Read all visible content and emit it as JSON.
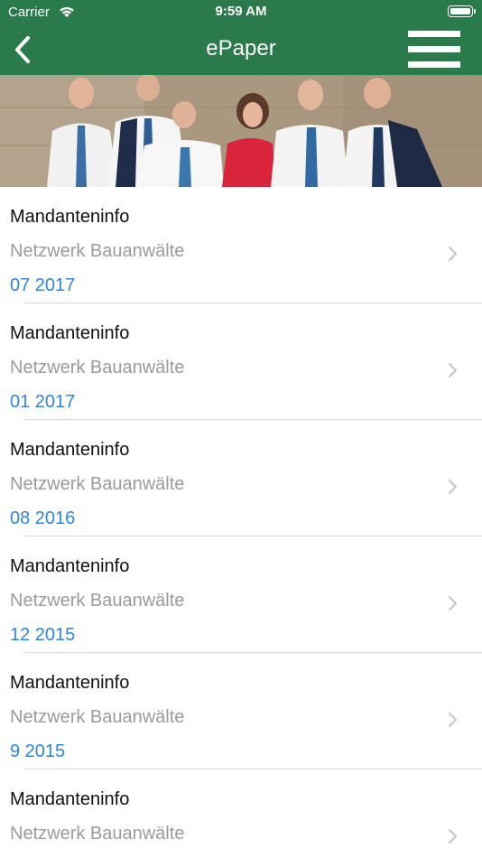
{
  "status_bar": {
    "carrier": "Carrier",
    "time": "9:59 AM"
  },
  "nav": {
    "title": "ePaper",
    "back_icon": "chevron-left-icon",
    "menu_icon": "hamburger-menu-icon"
  },
  "colors": {
    "header_green": "#2b7a4b",
    "primary_text": "#111111",
    "secondary_text": "#9b9b9b",
    "date_blue": "#2e86de"
  },
  "items": [
    {
      "title": "Mandanteninfo",
      "subtitle": "Netzwerk Bauanwälte",
      "date": "07 2017"
    },
    {
      "title": "Mandanteninfo",
      "subtitle": "Netzwerk Bauanwälte",
      "date": "01 2017"
    },
    {
      "title": "Mandanteninfo",
      "subtitle": "Netzwerk Bauanwälte",
      "date": "08 2016"
    },
    {
      "title": "Mandanteninfo",
      "subtitle": "Netzwerk Bauanwälte",
      "date": "12 2015"
    },
    {
      "title": "Mandanteninfo",
      "subtitle": "Netzwerk Bauanwälte",
      "date": "9 2015"
    },
    {
      "title": "Mandanteninfo",
      "subtitle": "Netzwerk Bauanwälte",
      "date": ""
    }
  ]
}
